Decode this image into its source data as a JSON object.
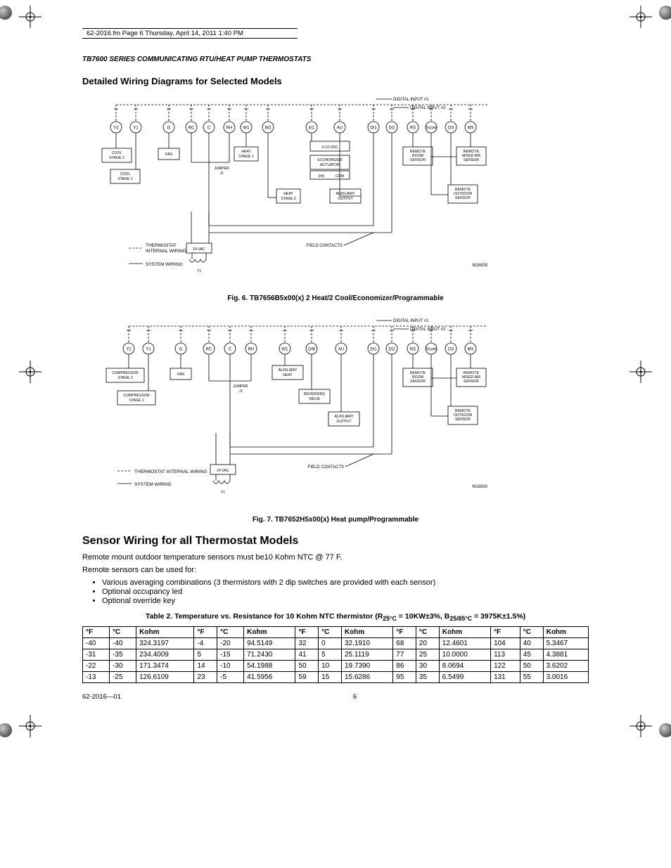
{
  "meta": {
    "header_tag": "62-2016.fm  Page 6  Thursday, April 14, 2011  1:40 PM",
    "doc_title": "TB7600 SERIES COMMUNICATING RTU/HEAT PUMP THERMOSTATS",
    "footer_left": "62-2016—01",
    "footer_center": "6"
  },
  "section1": {
    "heading": "Detailed Wiring Diagrams for Selected Models"
  },
  "fig6": {
    "caption": "Fig. 6. TB7656B5x00(x) 2 Heat/2 Cool/Economizer/Programmable",
    "id": "M16929",
    "terminals": [
      "Y2",
      "Y1",
      "G",
      "RC",
      "C",
      "RH",
      "W1",
      "W2",
      "EC",
      "AU",
      "DI1",
      "DI2",
      "RS",
      "Scom",
      "OS",
      "MS"
    ],
    "boxes": {
      "cool2": "COOL\nSTAGE 2",
      "cool1": "COOL\nSTAGE 1",
      "fan": "FAN",
      "heat1": "HEAT\nSTAGE 1",
      "jumper": "JUMPER\nJ1",
      "vdc": "0-10 VDC",
      "econ": "ECONOMIZER\nACTUATOR",
      "v24": "24V    COM",
      "auxout": "AUXILIARY\nOUTPUT",
      "heat2": "HEAT\nSTAGE 2",
      "rroom": "REMOTE\nROOM\nSENSOR",
      "rmixed": "REMOTE\nMIXED AIR\nSENSOR",
      "routdoor": "REMOTE\nOUTDOOR\nSENSOR",
      "di1_label": "DIGITAL INPUT #1",
      "di2_label": "DIGITAL INPUT #2",
      "field": "FIELD CONTACTS",
      "vac24": "24 VAC",
      "t1": "T1",
      "leg_int": "THERMOSTAT\nINTERNAL WIRING",
      "leg_sys": "SYSTEM WIRING"
    }
  },
  "fig7": {
    "caption": "Fig. 7. TB7652H5x00(x) Heat pump/Programmable",
    "id": "M16930",
    "terminals": [
      "Y2",
      "Y1",
      "G",
      "RC",
      "C",
      "RH",
      "W1",
      "O/B",
      "AU",
      "DI1",
      "DI2",
      "RS",
      "Scom",
      "OS",
      "MS"
    ],
    "boxes": {
      "comp2": "COMPRESSOR\nSTAGE 2",
      "comp1": "COMPRESSOR\nSTAGE 1",
      "fan": "FAN",
      "jumper": "JUMPER\nJ1",
      "auxheat": "AUXILIARY\nHEAT",
      "revvalve": "REVERSING\nVALVE",
      "auxout": "AUXILIARY\nOUTPUT",
      "rroom": "REMOTE\nROOM\nSENSOR",
      "rmixed": "REMOTE\nMIXED AIR\nSENSOR",
      "routdoor": "REMOTE\nOUTDOOR\nSENSOR",
      "di1_label": "DIGITAL INPUT #1",
      "di2_label": "DIGITAL INPUT #2",
      "field": "FIELD CONTACTS",
      "vac24": "24 VAC",
      "t1": "T1",
      "leg_int": "THERMOSTAT INTERNAL WIRING",
      "leg_sys": "SYSTEM WIRING"
    }
  },
  "section2": {
    "heading": "Sensor Wiring for all Thermostat Models",
    "p1": "Remote mount outdoor temperature sensors must be10 Kohm NTC @ 77 F.",
    "p2": "Remote sensors can be used for:",
    "bullets": [
      "Various averaging combinations (3 thermistors with 2 dip switches are provided with each sensor)",
      "Optional occupancy led",
      "Optional override key"
    ]
  },
  "table2": {
    "caption": "Table 2. Temperature vs. Resistance for 10 Kohm NTC thermistor (R25°C = 10KW±3%, B25/85°C = 3975K±1.5%)",
    "col_group_headers": [
      "°F",
      "°C",
      "Kohm",
      "°F",
      "°C",
      "Kohm",
      "°F",
      "°C",
      "Kohm",
      "°F",
      "°C",
      "Kohm",
      "°F",
      "°C",
      "Kohm",
      "°F",
      "°C",
      "Kohm"
    ],
    "rows": [
      [
        "-40",
        "-40",
        "324.3197",
        "-4",
        "-20",
        "94.5149",
        "32",
        "0",
        "32.1910",
        "68",
        "20",
        "12.4601",
        "104",
        "40",
        "5.3467"
      ],
      [
        "-31",
        "-35",
        "234.4009",
        "5",
        "-15",
        "71.2430",
        "41",
        "5",
        "25.1119",
        "77",
        "25",
        "10.0000",
        "113",
        "45",
        "4.3881"
      ],
      [
        "-22",
        "-30",
        "171.3474",
        "14",
        "-10",
        "54.1988",
        "50",
        "10",
        "19.7390",
        "86",
        "30",
        "8.0694",
        "122",
        "50",
        "3.6202"
      ],
      [
        "-13",
        "-25",
        "126.6109",
        "23",
        "-5",
        "41.5956",
        "59",
        "15",
        "15.6286",
        "95",
        "35",
        "6.5499",
        "131",
        "55",
        "3.0016"
      ]
    ]
  },
  "chart_data": {
    "type": "table",
    "title": "Temperature vs. Resistance for 10 Kohm NTC thermistor",
    "columns": [
      "°F",
      "°C",
      "Kohm"
    ],
    "data": [
      [
        -40,
        -40,
        324.3197
      ],
      [
        -31,
        -35,
        234.4009
      ],
      [
        -22,
        -30,
        171.3474
      ],
      [
        -13,
        -25,
        126.6109
      ],
      [
        -4,
        -20,
        94.5149
      ],
      [
        5,
        -15,
        71.243
      ],
      [
        14,
        -10,
        54.1988
      ],
      [
        23,
        -5,
        41.5956
      ],
      [
        32,
        0,
        32.191
      ],
      [
        41,
        5,
        25.1119
      ],
      [
        50,
        10,
        19.739
      ],
      [
        59,
        15,
        15.6286
      ],
      [
        68,
        20,
        12.4601
      ],
      [
        77,
        25,
        10.0
      ],
      [
        86,
        30,
        8.0694
      ],
      [
        95,
        35,
        6.5499
      ],
      [
        104,
        40,
        5.3467
      ],
      [
        113,
        45,
        4.3881
      ],
      [
        122,
        50,
        3.6202
      ],
      [
        131,
        55,
        3.0016
      ]
    ],
    "parameters": {
      "R_25C": "10KΩ ±3%",
      "B_25_85C": "3975K ±1.5%"
    }
  }
}
